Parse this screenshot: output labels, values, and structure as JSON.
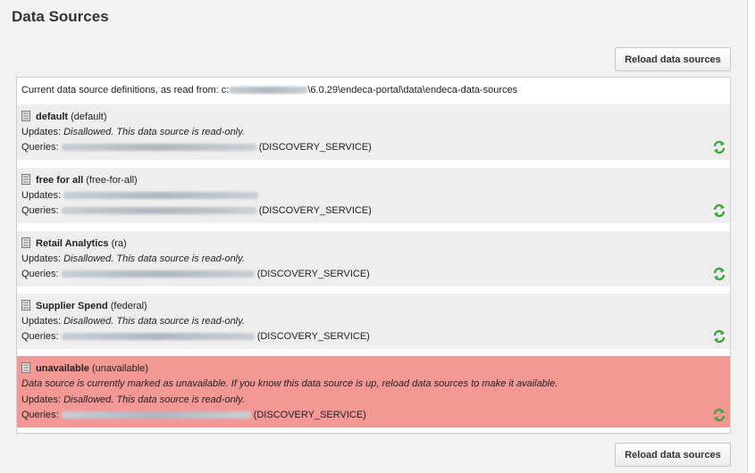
{
  "page": {
    "title": "Data Sources"
  },
  "toolbar": {
    "reload_top": "Reload data sources",
    "reload_bottom": "Reload data sources"
  },
  "definitions": {
    "prefix": "Current data source definitions, as read from: c:",
    "suffix": "\\6.0.29\\endeca-portal\\data\\endeca-data-sources"
  },
  "sources": [
    {
      "name": "default",
      "id": "(default)",
      "updates_label": "Updates:",
      "updates": "Disallowed. This data source is read-only.",
      "queries_label": "Queries:",
      "service": "(DISCOVERY_SERVICE)"
    },
    {
      "name": "free for all",
      "id": "(free-for-all)",
      "updates_label": "Updates:",
      "updates": "",
      "queries_label": "Queries:",
      "service": "(DISCOVERY_SERVICE)"
    },
    {
      "name": "Retail Analytics",
      "id": "(ra)",
      "updates_label": "Updates:",
      "updates": "Disallowed. This data source is read-only.",
      "queries_label": "Queries:",
      "service": "(DISCOVERY_SERVICE)"
    },
    {
      "name": "Supplier Spend",
      "id": "(federal)",
      "updates_label": "Updates:",
      "updates": "Disallowed. This data source is read-only.",
      "queries_label": "Queries:",
      "service": "(DISCOVERY_SERVICE)"
    },
    {
      "name": "unavailable",
      "id": "(unavailable)",
      "warning": "Data source is currently marked as unavailable. If you know this data source is up, reload data sources to make it available.",
      "updates_label": "Updates:",
      "updates": "Disallowed. This data source is read-only.",
      "queries_label": "Queries:",
      "service": "(DISCOVERY_SERVICE)"
    }
  ],
  "icons": {
    "source": "database-icon",
    "refresh": "refresh-icon"
  },
  "colors": {
    "unavailable_bg": "#f39895",
    "refresh_green": "#3aa53a"
  }
}
